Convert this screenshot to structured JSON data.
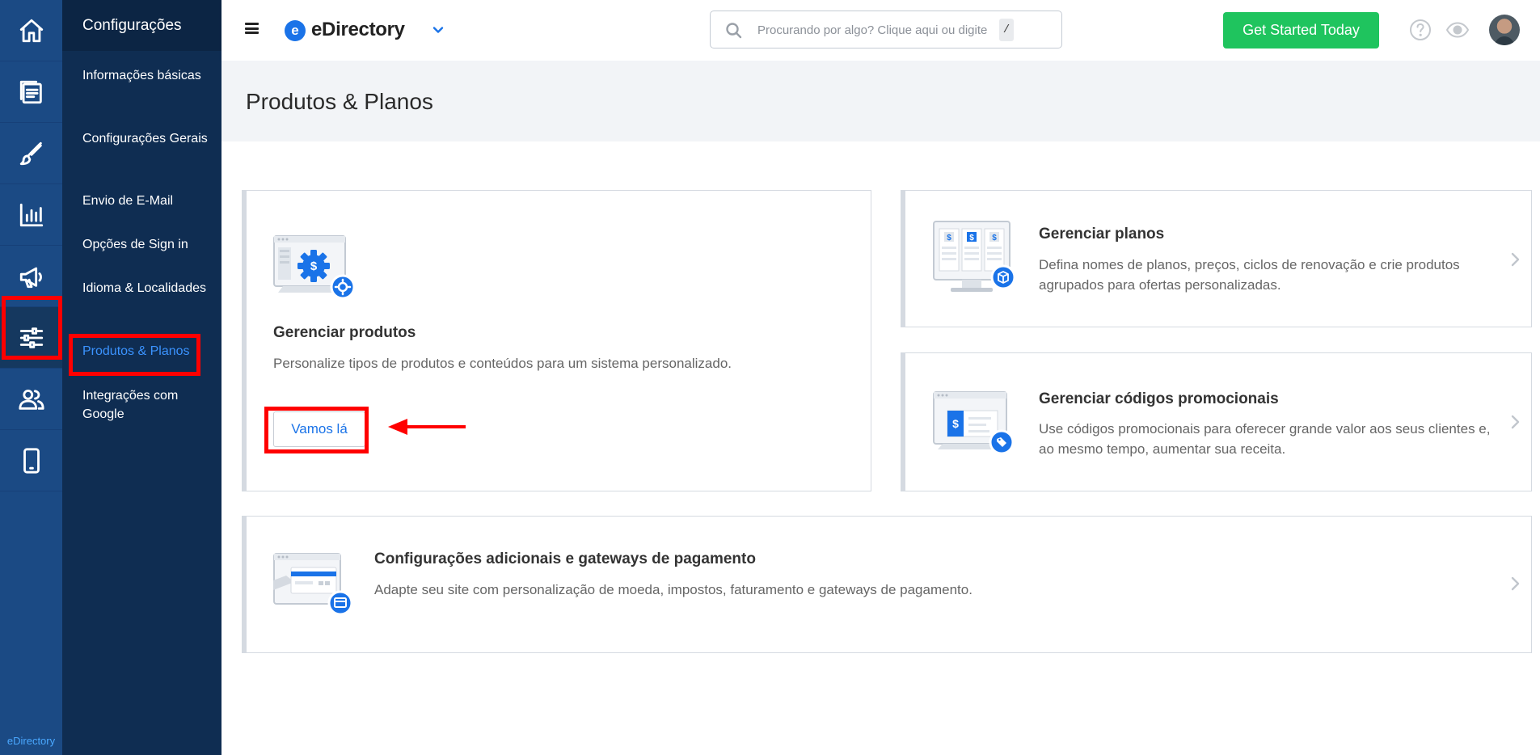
{
  "rail": {
    "items": [
      {
        "icon": "home-icon"
      },
      {
        "icon": "content-icon"
      },
      {
        "icon": "brush-icon"
      },
      {
        "icon": "chart-icon"
      },
      {
        "icon": "megaphone-icon"
      },
      {
        "icon": "settings-sliders-icon",
        "active": true
      },
      {
        "icon": "users-icon"
      },
      {
        "icon": "mobile-icon"
      }
    ],
    "brand": "eDirectory"
  },
  "subnav": {
    "title": "Configurações",
    "items": [
      {
        "label": "Informações básicas"
      },
      {
        "label": "Configurações Gerais"
      },
      {
        "label": "Envio de E-Mail"
      },
      {
        "label": "Opções de Sign in"
      },
      {
        "label": "Idioma & Localidades"
      },
      {
        "label": "Produtos & Planos",
        "active": true
      },
      {
        "label": "Integrações com Google"
      }
    ]
  },
  "topbar": {
    "logo_letter": "e",
    "logo_text": "eDirectory",
    "search_placeholder": "Procurando por algo? Clique aqui ou digite",
    "search_shortcut": "/",
    "cta_label": "Get Started Today",
    "icons": [
      "menu-icon",
      "search-icon",
      "help-icon",
      "eye-icon",
      "avatar"
    ]
  },
  "page": {
    "title": "Produtos & Planos"
  },
  "cards": {
    "products": {
      "title": "Gerenciar produtos",
      "description": "Personalize tipos de produtos e conteúdos para um sistema personalizado.",
      "button": "Vamos lá"
    },
    "plans": {
      "title": "Gerenciar planos",
      "description": "Defina nomes de planos, preços, ciclos de renovação e crie produtos agrupados para ofertas personalizadas."
    },
    "promo": {
      "title": "Gerenciar códigos promocionais",
      "description": "Use códigos promocionais para oferecer grande valor aos seus clientes e, ao mesmo tempo, aumentar sua receita."
    },
    "payment": {
      "title": "Configurações adicionais e gateways de pagamento",
      "description": "Adapte seu site com personalização de moeda, impostos, faturamento e gateways de pagamento."
    }
  },
  "colors": {
    "rail": "#1b4a84",
    "subnav": "#0f2d52",
    "accent_blue": "#1a73e8",
    "cta_green": "#1fc45e",
    "highlight_red": "#ff0000"
  }
}
